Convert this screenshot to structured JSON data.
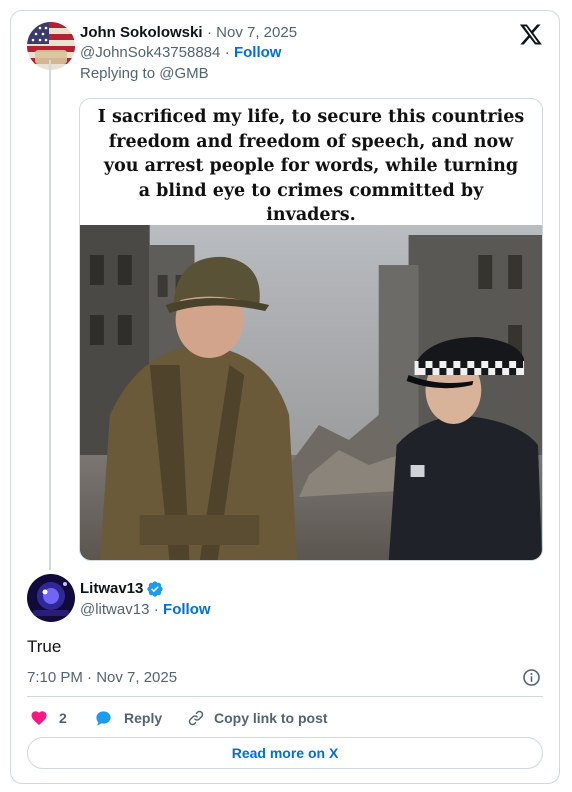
{
  "reply_context": {
    "author_name": "John Sokolowski",
    "date": "Nov 7, 2025",
    "handle": "@JohnSok43758884",
    "follow_label": "Follow",
    "replying_to": "Replying to @GMB",
    "image_caption_lines": [
      "I sacrificed my life, to secure this countries",
      "freedom and freedom of speech, and now",
      "you arrest people for words, while turning",
      "a blind eye to crimes committed by",
      "invaders."
    ]
  },
  "tweet": {
    "author_name": "Litwav13",
    "handle": "@litwav13",
    "follow_label": "Follow",
    "text": "True",
    "timestamp": "7:10 PM · Nov 7, 2025",
    "verified": true
  },
  "actions": {
    "like_count": "2",
    "reply_label": "Reply",
    "copy_link_label": "Copy link to post",
    "read_more_label": "Read more on X"
  },
  "icons": {
    "logo": "x-logo-icon",
    "info": "info-icon",
    "like": "heart-icon",
    "reply": "speech-bubble-icon",
    "copy": "link-icon",
    "verified": "verified-badge-icon"
  },
  "colors": {
    "accent": "#006fd6",
    "like": "#f91880",
    "verified": "#1d9bf0",
    "muted": "#536471",
    "border": "#cfd9de"
  }
}
